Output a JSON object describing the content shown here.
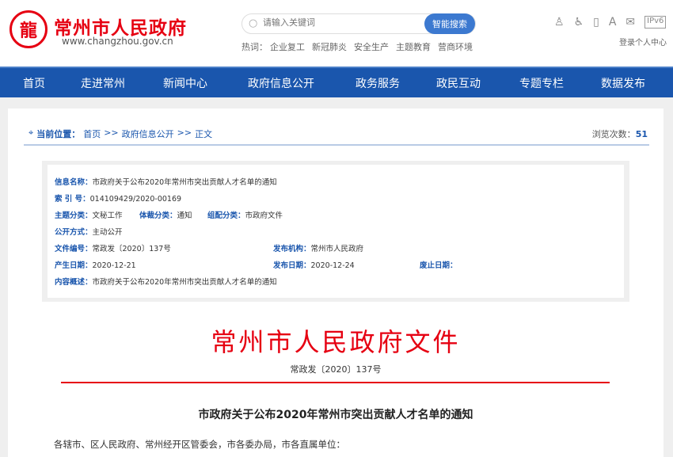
{
  "header": {
    "site_name": "常州市人民政府",
    "site_url": "www.changzhou.gov.cn",
    "search_placeholder": "请输入关键词",
    "search_button": "智能搜索",
    "hot_label": "热词：",
    "hot_words": [
      "企业复工",
      "新冠肺炎",
      "安全生产",
      "主题教育",
      "营商环境"
    ],
    "tools": [
      "♙",
      "♿",
      "▯",
      "A",
      "✉",
      "IPv6"
    ],
    "login": "登录个人中心"
  },
  "nav": [
    "首页",
    "走进常州",
    "新闻中心",
    "政府信息公开",
    "政务服务",
    "政民互动",
    "专题专栏",
    "数据发布"
  ],
  "breadcrumb": {
    "label": "当前位置：",
    "items": [
      "首页",
      ">>",
      "政府信息公开",
      ">>",
      "正文"
    ],
    "views_label": "浏览次数：",
    "views": "51"
  },
  "info": {
    "name_label": "信息名称：",
    "name": "市政府关于公布2020年常州市突出贡献人才名单的通知",
    "index_label": "索 引 号：",
    "index": "014109429/2020-00169",
    "topic_label": "主题分类：",
    "topic": "文秘工作",
    "genre_label": "体裁分类：",
    "genre": "通知",
    "org_cat_label": "组配分类：",
    "org_cat": "市政府文件",
    "open_label": "公开方式：",
    "open": "主动公开",
    "docno_label": "文件编号：",
    "docno": "常政发〔2020〕137号",
    "publisher_label": "发布机构：",
    "publisher": "常州市人民政府",
    "created_label": "产生日期：",
    "created": "2020-12-21",
    "published_label": "发布日期：",
    "published": "2020-12-24",
    "expiry_label": "废止日期：",
    "summary_label": "内容概述：",
    "summary": "市政府关于公布2020年常州市突出贡献人才名单的通知"
  },
  "document": {
    "red_title": "常州市人民政府文件",
    "doc_number": "常政发〔2020〕137号",
    "title": "市政府关于公布2020年常州市突出贡献人才名单的通知",
    "salutation": "各辖市、区人民政府、常州经开区管委会，市各委办局，市各直属单位："
  }
}
